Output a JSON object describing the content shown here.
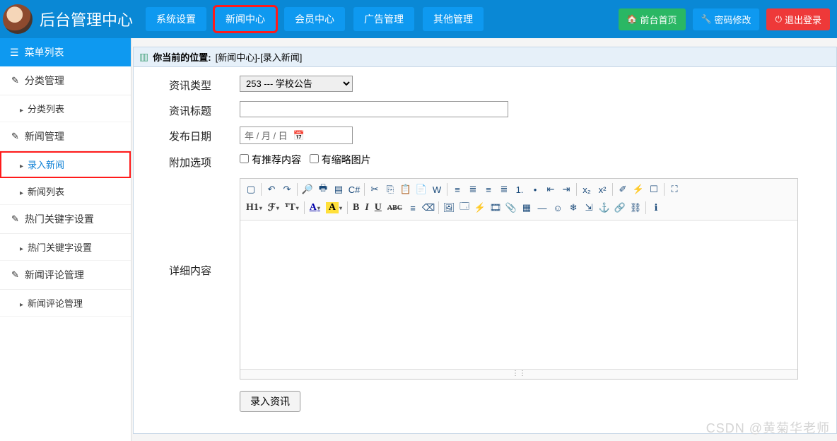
{
  "header": {
    "brand": "后台管理中心",
    "nav": [
      "系统设置",
      "新闻中心",
      "会员中心",
      "广告管理",
      "其他管理"
    ],
    "nav_active_index": 1,
    "actions": {
      "front": "前台首页",
      "pwd": "密码修改",
      "logout": "退出登录"
    }
  },
  "sidebar": {
    "title": "菜单列表",
    "groups": [
      {
        "label": "分类管理",
        "items": [
          "分类列表"
        ]
      },
      {
        "label": "新闻管理",
        "items": [
          "录入新闻",
          "新闻列表"
        ],
        "active_item": 0
      },
      {
        "label": "热门关键字设置",
        "items": [
          "热门关键字设置"
        ]
      },
      {
        "label": "新闻评论管理",
        "items": [
          "新闻评论管理"
        ]
      }
    ]
  },
  "breadcrumb": {
    "label": "你当前的位置:",
    "path": "[新闻中心]-[录入新闻]"
  },
  "form": {
    "type_label": "资讯类型",
    "type_value": "253 --- 学校公告",
    "title_label": "资讯标题",
    "title_value": "",
    "date_label": "发布日期",
    "date_placeholder": "年  / 月 / 日",
    "extra_label": "附加选项",
    "extra_opts": [
      "有推荐内容",
      "有缩略图片"
    ],
    "content_label": "详细内容",
    "submit": "录入资讯"
  },
  "editor": {
    "row1": [
      {
        "n": "source-icon",
        "g": "▢"
      },
      {
        "sep": true
      },
      {
        "n": "undo-icon",
        "g": "↶"
      },
      {
        "n": "redo-icon",
        "g": "↷"
      },
      {
        "sep": true
      },
      {
        "n": "preview-icon",
        "g": "🔎"
      },
      {
        "n": "print-icon",
        "g": "🖶"
      },
      {
        "n": "template-icon",
        "g": "▤"
      },
      {
        "n": "code-icon",
        "g": "C#"
      },
      {
        "sep": true
      },
      {
        "n": "cut-icon",
        "g": "✂"
      },
      {
        "n": "copy-icon",
        "g": "⎘"
      },
      {
        "n": "paste-icon",
        "g": "📋"
      },
      {
        "n": "paste-text-icon",
        "g": "📄"
      },
      {
        "n": "paste-word-icon",
        "g": "W"
      },
      {
        "sep": true
      },
      {
        "n": "align-left-icon",
        "g": "≡"
      },
      {
        "n": "align-center-icon",
        "g": "≣"
      },
      {
        "n": "align-right-icon",
        "g": "≡"
      },
      {
        "n": "align-justify-icon",
        "g": "≣"
      },
      {
        "n": "list-ol-icon",
        "g": "1."
      },
      {
        "n": "list-ul-icon",
        "g": "•"
      },
      {
        "n": "outdent-icon",
        "g": "⇤"
      },
      {
        "n": "indent-icon",
        "g": "⇥"
      },
      {
        "sep": true
      },
      {
        "n": "subscript-icon",
        "g": "x₂"
      },
      {
        "n": "superscript-icon",
        "g": "x²"
      },
      {
        "sep": true
      },
      {
        "n": "clear-format-icon",
        "g": "✐"
      },
      {
        "n": "quick-format-icon",
        "g": "⚡"
      },
      {
        "n": "select-all-icon",
        "g": "☐"
      },
      {
        "sep": true
      },
      {
        "n": "fullscreen-icon",
        "g": "⛶"
      }
    ],
    "row2": [
      {
        "n": "heading-sel",
        "lab": "H1",
        "car": true
      },
      {
        "n": "font-family-sel",
        "lab": "ℱ",
        "car": true
      },
      {
        "n": "font-size-sel",
        "lab": "ᵀT",
        "car": true
      },
      {
        "sep": true
      },
      {
        "n": "font-color-sel",
        "lab": "A",
        "car": true,
        "style": "color:#00a;text-decoration:underline"
      },
      {
        "n": "bg-color-sel",
        "cls": "hiA",
        "lab": "A",
        "car": true
      },
      {
        "sep": true
      },
      {
        "n": "bold-icon",
        "lab": "B",
        "style": "font-weight:700"
      },
      {
        "n": "italic-icon",
        "lab": "I",
        "style": "font-style:italic;font-family:serif"
      },
      {
        "n": "underline-icon",
        "lab": "U",
        "style": "text-decoration:underline"
      },
      {
        "n": "strike-icon",
        "lab": "ABC",
        "style": "text-decoration:line-through;font-size:10px"
      },
      {
        "n": "line-height-icon",
        "g": "≡"
      },
      {
        "n": "remove-format-icon",
        "g": "⌫"
      },
      {
        "sep": true
      },
      {
        "n": "image-icon",
        "g": "🖼"
      },
      {
        "n": "multi-image-icon",
        "g": "🗔"
      },
      {
        "n": "flash-icon",
        "g": "⚡"
      },
      {
        "n": "media-icon",
        "g": "🎞"
      },
      {
        "n": "file-icon",
        "g": "📎"
      },
      {
        "n": "table-icon",
        "g": "▦"
      },
      {
        "n": "hr-icon",
        "g": "—"
      },
      {
        "n": "emoji-icon",
        "g": "☺"
      },
      {
        "n": "special-char-icon",
        "g": "❄"
      },
      {
        "n": "pagebreak-icon",
        "g": "⇲"
      },
      {
        "n": "anchor-icon",
        "g": "⚓"
      },
      {
        "n": "link-icon",
        "g": "🔗"
      },
      {
        "n": "unlink-icon",
        "g": "⛓"
      },
      {
        "sep": true
      },
      {
        "n": "about-icon",
        "g": "ℹ"
      }
    ]
  },
  "watermark": "CSDN @黄菊华老师"
}
